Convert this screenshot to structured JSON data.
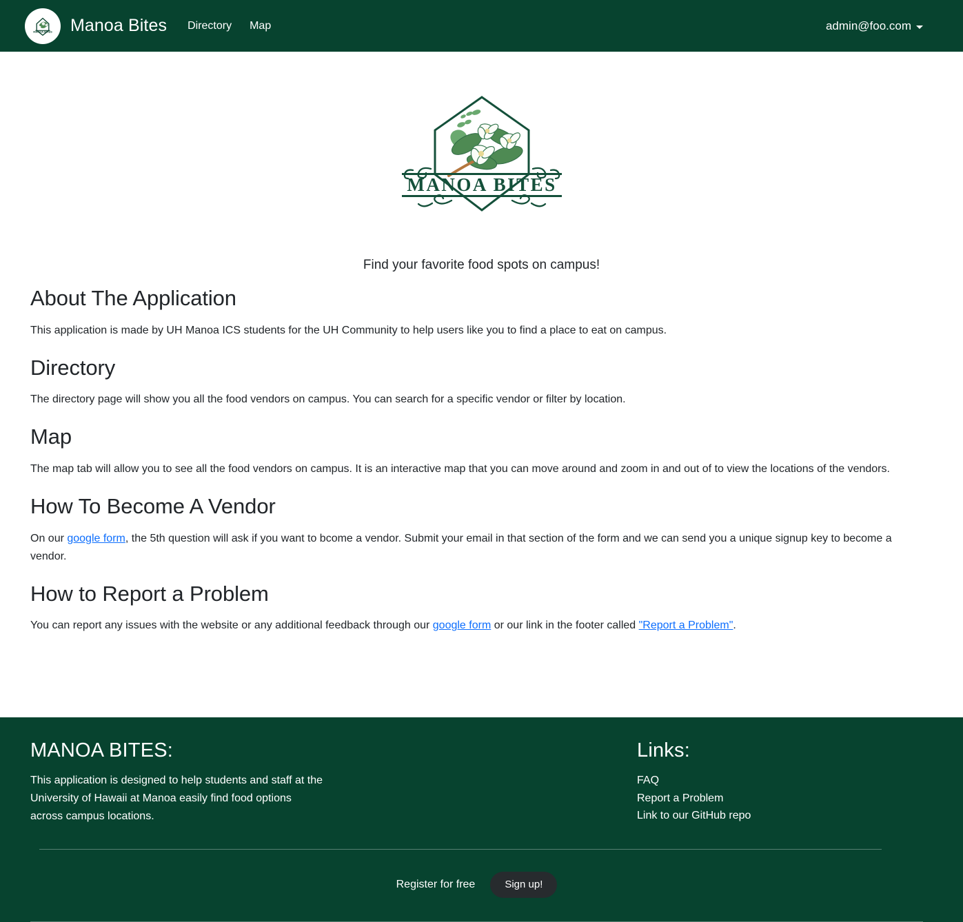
{
  "colors": {
    "brand_green": "#07432f",
    "link_blue": "#0d6efd",
    "signup_dark": "#272b2e",
    "text": "#212529"
  },
  "navbar": {
    "logo_icon": "manoa-bites-badge-icon",
    "brand": "Manoa Bites",
    "links": [
      {
        "label": "Directory"
      },
      {
        "label": "Map"
      }
    ],
    "user": {
      "email": "admin@foo.com",
      "caret_icon": "chevron-down-icon"
    }
  },
  "hero": {
    "logo_icon": "manoa-bites-logo-icon",
    "logo_text": "MANOA BITES",
    "tagline": "Find your favorite food spots on campus!"
  },
  "sections": [
    {
      "heading": "About The Application",
      "body_before": "This application is made by UH Manoa ICS students for the UH Community to help users like you to find a place to eat on campus.",
      "link1": "",
      "body_mid": "",
      "link2": "",
      "body_after": ""
    },
    {
      "heading": "Directory",
      "body_before": "The directory page will show you all the food vendors on campus. You can search for a specific vendor or filter by location.",
      "link1": "",
      "body_mid": "",
      "link2": "",
      "body_after": ""
    },
    {
      "heading": "Map",
      "body_before": "The map tab will allow you to see all the food vendors on campus. It is an interactive map that you can move around and zoom in and out of to view the locations of the vendors.",
      "link1": "",
      "body_mid": "",
      "link2": "",
      "body_after": ""
    },
    {
      "heading": "How To Become A Vendor",
      "body_before": "On our ",
      "link1": "google form",
      "body_mid": ", the 5th question will ask if you want to bcome a vendor. Submit your email in that section of the form and we can send you a unique signup key to become a vendor.",
      "link2": "",
      "body_after": ""
    },
    {
      "heading": "How to Report a Problem",
      "body_before": "You can report any issues with the website or any additional feedback through our ",
      "link1": "google form",
      "body_mid": " or our link in the footer called ",
      "link2": "\"Report a Problem\"",
      "body_after": "."
    }
  ],
  "footer": {
    "title": "MANOA BITES:",
    "description": "This application is designed to help students and staff at the University of Hawaii at Manoa easily find food options across campus locations.",
    "links_title": "Links:",
    "links": [
      {
        "label": "FAQ"
      },
      {
        "label": "Report a Problem"
      },
      {
        "label": "Link to our GitHub repo"
      }
    ],
    "register_text": "Register for free",
    "signup_label": "Sign up!"
  }
}
